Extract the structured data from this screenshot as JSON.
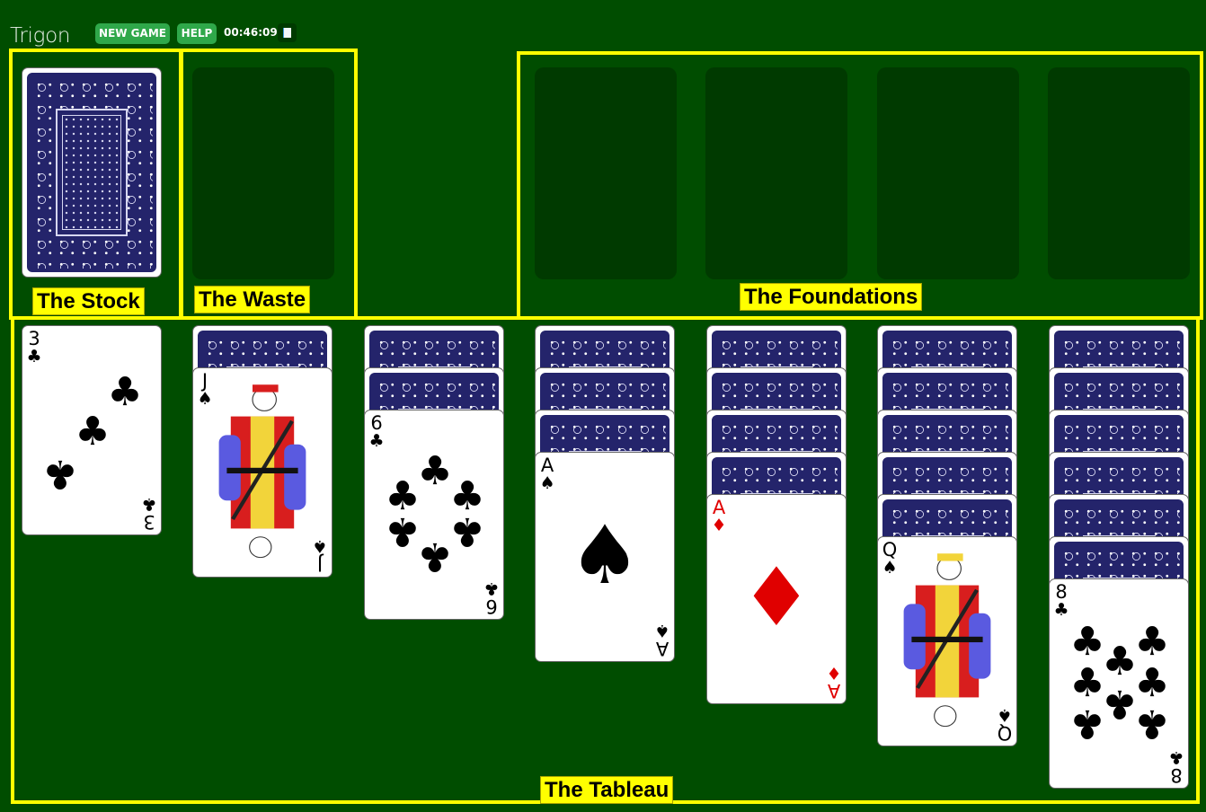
{
  "header": {
    "app_title": "Trigon",
    "new_game_label": "NEW GAME",
    "help_label": "HELP",
    "timer": "00:46:09",
    "pause_icon": "pause-icon"
  },
  "labels": {
    "stock": "The Stock",
    "waste": "The Waste",
    "foundations": "The Foundations",
    "tableau": "The Tableau"
  },
  "colors": {
    "table_green": "#004d00",
    "slot_green": "#003a00",
    "annotation_yellow": "#ffff00",
    "button_green": "#2fa84a",
    "card_back_blue": "#24246b",
    "red_suit": "#e00000"
  },
  "stock": {
    "face_down_cards_visible": 1
  },
  "waste": {
    "cards": []
  },
  "foundations": [
    {
      "cards": []
    },
    {
      "cards": []
    },
    {
      "cards": []
    },
    {
      "cards": []
    }
  ],
  "tableau": [
    {
      "face_down": 0,
      "top": {
        "rank": "3",
        "suit": "♣",
        "suit_name": "clubs",
        "color": "black"
      }
    },
    {
      "face_down": 1,
      "top": {
        "rank": "J",
        "suit": "♠",
        "suit_name": "spades",
        "color": "black"
      }
    },
    {
      "face_down": 2,
      "top": {
        "rank": "6",
        "suit": "♣",
        "suit_name": "clubs",
        "color": "black"
      }
    },
    {
      "face_down": 3,
      "top": {
        "rank": "A",
        "suit": "♠",
        "suit_name": "spades",
        "color": "black"
      }
    },
    {
      "face_down": 4,
      "top": {
        "rank": "A",
        "suit": "♦",
        "suit_name": "diamonds",
        "color": "red"
      }
    },
    {
      "face_down": 5,
      "top": {
        "rank": "Q",
        "suit": "♠",
        "suit_name": "spades",
        "color": "black"
      }
    },
    {
      "face_down": 6,
      "top": {
        "rank": "8",
        "suit": "♣",
        "suit_name": "clubs",
        "color": "black"
      }
    }
  ]
}
